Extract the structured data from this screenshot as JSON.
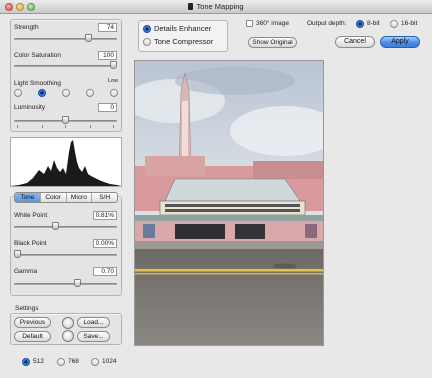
{
  "window": {
    "title": "Tone Mapping"
  },
  "sliders": {
    "strength": {
      "label": "Strength",
      "value": "74",
      "level": 0.74
    },
    "color_saturation": {
      "label": "Color Saturation",
      "value": "100",
      "level": 1.0
    },
    "luminosity": {
      "label": "Luminosity",
      "value": "0",
      "level": 0.5
    },
    "white_point": {
      "label": "White Point",
      "value": "0.81%",
      "level": 0.4
    },
    "black_point": {
      "label": "Black Point",
      "value": "0.00%",
      "level": 0.0
    },
    "gamma": {
      "label": "Gamma",
      "value": "0.70",
      "level": 0.62
    }
  },
  "light_smoothing": {
    "label": "Light Smoothing",
    "low_label": "Low",
    "options_count": 5,
    "selected_index": 1
  },
  "tabs": {
    "items": [
      "Tone",
      "Color",
      "Micro",
      "S/H"
    ],
    "active": "Tone"
  },
  "settings": {
    "title": "Settings",
    "previous": "Previous",
    "default": "Default",
    "load": "Load...",
    "save": "Save..."
  },
  "preview_size": {
    "options": [
      "512",
      "768",
      "1024"
    ],
    "selected": "512"
  },
  "method": {
    "details_enhancer": "Details Enhancer",
    "tone_compressor": "Tone Compressor",
    "selected": "Details Enhancer"
  },
  "top_options": {
    "image_360_label": "360° image",
    "image_360_checked": false,
    "show_original": "Show Original",
    "output_depth_label": "Output depth:",
    "depth_8": "8-bit",
    "depth_16": "16-bit",
    "selected_depth": "8-bit"
  },
  "actions": {
    "cancel": "Cancel",
    "apply": "Apply"
  },
  "colors": {
    "accent": "#3a7ee0",
    "panel": "#e4e4e4",
    "window": "#e8e8e8"
  }
}
